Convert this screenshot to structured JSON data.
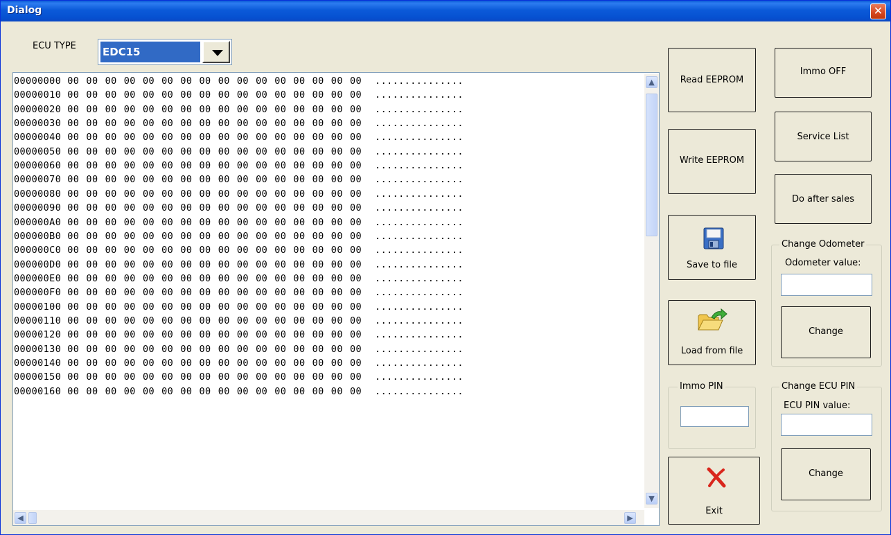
{
  "window": {
    "title": "Dialog",
    "close_glyph": "✕"
  },
  "ecu_type": {
    "label": "ECU TYPE",
    "selected": "EDC15"
  },
  "hex_view": {
    "rows": [
      {
        "address": "00000000",
        "bytes": "00 00 00 00 00 00 00 00 00 00 00 00 00 00 00 00",
        "ascii": "..............."
      },
      {
        "address": "00000010",
        "bytes": "00 00 00 00 00 00 00 00 00 00 00 00 00 00 00 00",
        "ascii": "..............."
      },
      {
        "address": "00000020",
        "bytes": "00 00 00 00 00 00 00 00 00 00 00 00 00 00 00 00",
        "ascii": "..............."
      },
      {
        "address": "00000030",
        "bytes": "00 00 00 00 00 00 00 00 00 00 00 00 00 00 00 00",
        "ascii": "..............."
      },
      {
        "address": "00000040",
        "bytes": "00 00 00 00 00 00 00 00 00 00 00 00 00 00 00 00",
        "ascii": "..............."
      },
      {
        "address": "00000050",
        "bytes": "00 00 00 00 00 00 00 00 00 00 00 00 00 00 00 00",
        "ascii": "..............."
      },
      {
        "address": "00000060",
        "bytes": "00 00 00 00 00 00 00 00 00 00 00 00 00 00 00 00",
        "ascii": "..............."
      },
      {
        "address": "00000070",
        "bytes": "00 00 00 00 00 00 00 00 00 00 00 00 00 00 00 00",
        "ascii": "..............."
      },
      {
        "address": "00000080",
        "bytes": "00 00 00 00 00 00 00 00 00 00 00 00 00 00 00 00",
        "ascii": "..............."
      },
      {
        "address": "00000090",
        "bytes": "00 00 00 00 00 00 00 00 00 00 00 00 00 00 00 00",
        "ascii": "..............."
      },
      {
        "address": "000000A0",
        "bytes": "00 00 00 00 00 00 00 00 00 00 00 00 00 00 00 00",
        "ascii": "..............."
      },
      {
        "address": "000000B0",
        "bytes": "00 00 00 00 00 00 00 00 00 00 00 00 00 00 00 00",
        "ascii": "..............."
      },
      {
        "address": "000000C0",
        "bytes": "00 00 00 00 00 00 00 00 00 00 00 00 00 00 00 00",
        "ascii": "..............."
      },
      {
        "address": "000000D0",
        "bytes": "00 00 00 00 00 00 00 00 00 00 00 00 00 00 00 00",
        "ascii": "..............."
      },
      {
        "address": "000000E0",
        "bytes": "00 00 00 00 00 00 00 00 00 00 00 00 00 00 00 00",
        "ascii": "..............."
      },
      {
        "address": "000000F0",
        "bytes": "00 00 00 00 00 00 00 00 00 00 00 00 00 00 00 00",
        "ascii": "..............."
      },
      {
        "address": "00000100",
        "bytes": "00 00 00 00 00 00 00 00 00 00 00 00 00 00 00 00",
        "ascii": "..............."
      },
      {
        "address": "00000110",
        "bytes": "00 00 00 00 00 00 00 00 00 00 00 00 00 00 00 00",
        "ascii": "..............."
      },
      {
        "address": "00000120",
        "bytes": "00 00 00 00 00 00 00 00 00 00 00 00 00 00 00 00",
        "ascii": "..............."
      },
      {
        "address": "00000130",
        "bytes": "00 00 00 00 00 00 00 00 00 00 00 00 00 00 00 00",
        "ascii": "..............."
      },
      {
        "address": "00000140",
        "bytes": "00 00 00 00 00 00 00 00 00 00 00 00 00 00 00 00",
        "ascii": "..............."
      },
      {
        "address": "00000150",
        "bytes": "00 00 00 00 00 00 00 00 00 00 00 00 00 00 00 00",
        "ascii": "..............."
      },
      {
        "address": "00000160",
        "bytes": "00 00 00 00 00 00 00 00 00 00 00 00 00 00 00 00",
        "ascii": "..............."
      }
    ]
  },
  "buttons": {
    "read_eeprom": "Read EEPROM",
    "write_eeprom": "Write EEPROM",
    "save_to_file": "Save to file",
    "load_from_file": "Load from file",
    "exit": "Exit",
    "immo_off": "Immo OFF",
    "service_list": "Service List",
    "do_after_sales": "Do after sales"
  },
  "immo_pin": {
    "title": "Immo PIN",
    "value": ""
  },
  "odometer": {
    "title": "Change Odometer",
    "field_label": "Odometer value:",
    "value": "",
    "button": "Change"
  },
  "ecu_pin": {
    "title": "Change  ECU PIN",
    "field_label": "ECU PIN value:",
    "value": "",
    "button": "Change"
  },
  "icons": {
    "save": "floppy-disk-icon",
    "load": "open-folder-icon",
    "exit": "red-x-icon",
    "close": "close-icon"
  },
  "colors": {
    "titlebar": "#0a5bd6",
    "selection": "#316ac5",
    "dialog_bg": "#ece9d8",
    "close": "#d6451f"
  }
}
